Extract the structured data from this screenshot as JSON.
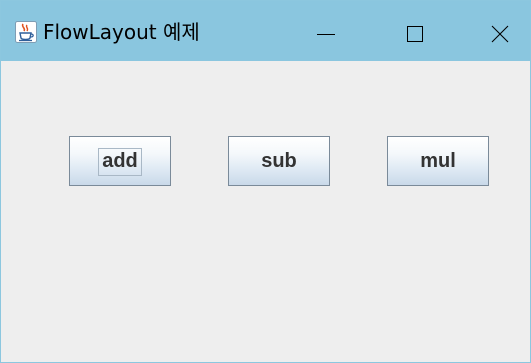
{
  "window": {
    "title": "FlowLayout 예제",
    "icon": "java-cup-icon",
    "controls": {
      "minimize_icon": "minimize-icon",
      "maximize_icon": "maximize-icon",
      "close_icon": "close-icon"
    }
  },
  "buttons": [
    {
      "label": "add",
      "focused": true
    },
    {
      "label": "sub",
      "focused": false
    },
    {
      "label": "mul",
      "focused": false
    }
  ],
  "colors": {
    "titlebar": "#8ac6df",
    "content_bg": "#eeeeee",
    "button_border": "#7a8a99",
    "button_text": "#333333"
  }
}
